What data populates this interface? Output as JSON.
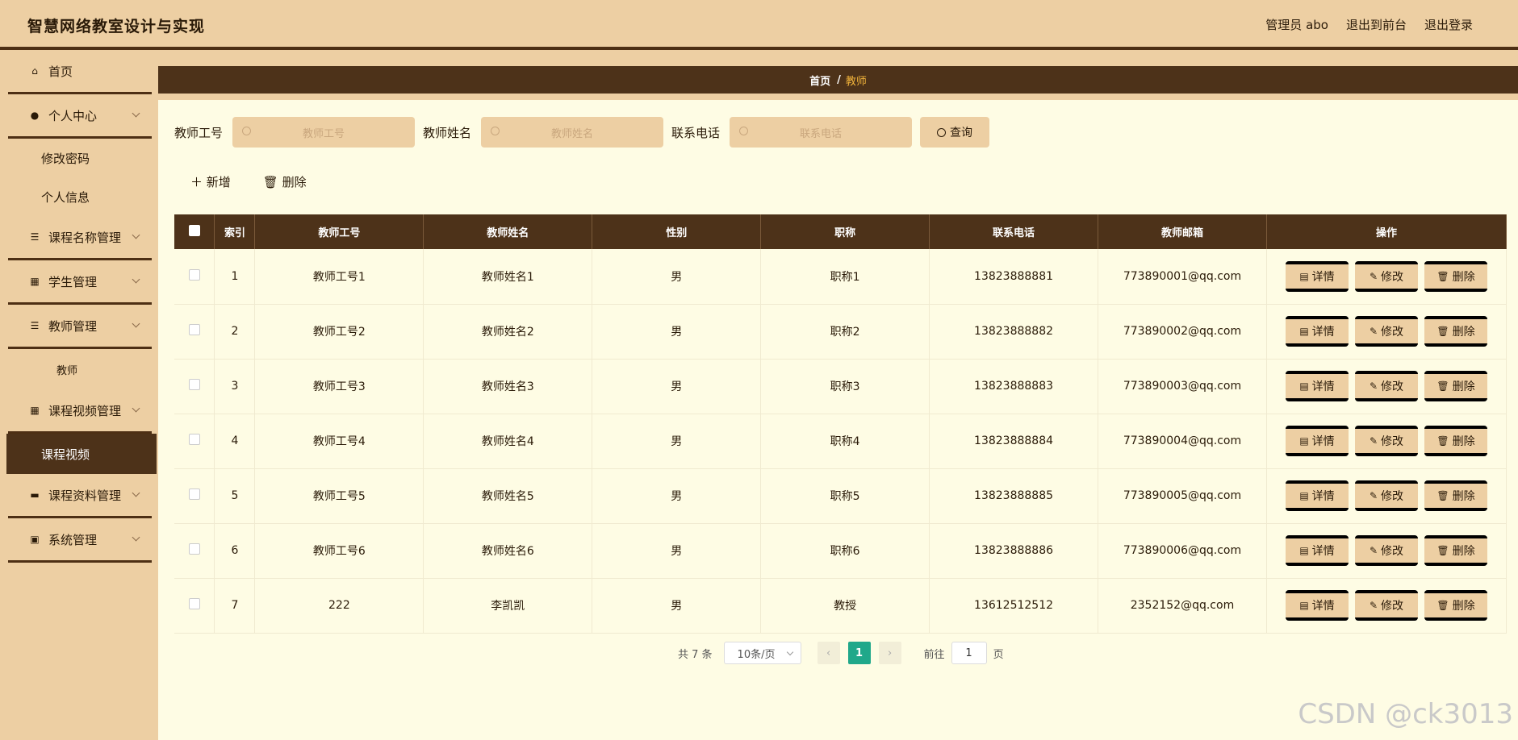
{
  "app": {
    "title": "智慧网络教室设计与实现"
  },
  "topnav": {
    "user": "管理员 abo",
    "front": "退出到前台",
    "logout": "退出登录"
  },
  "sidebar": {
    "home": "首页",
    "personal": "个人中心",
    "change_pwd": "修改密码",
    "profile": "个人信息",
    "course_name": "课程名称管理",
    "student": "学生管理",
    "teacher": "教师管理",
    "teacher_sub": "教师",
    "course_video": "课程视频管理",
    "course_video_sub": "课程视频",
    "course_material": "课程资料管理",
    "system": "系统管理"
  },
  "breadcrumb": {
    "home": "首页",
    "current": "教师"
  },
  "search": {
    "id_label": "教师工号",
    "id_placeholder": "教师工号",
    "name_label": "教师姓名",
    "name_placeholder": "教师姓名",
    "phone_label": "联系电话",
    "phone_placeholder": "联系电话",
    "button": "查询"
  },
  "toolbar": {
    "add": "新增",
    "delete": "删除"
  },
  "table": {
    "headers": [
      "索引",
      "教师工号",
      "教师姓名",
      "性别",
      "职称",
      "联系电话",
      "教师邮箱",
      "操作"
    ],
    "op_labels": {
      "detail": "详情",
      "edit": "修改",
      "delete": "删除"
    },
    "rows": [
      {
        "index": "1",
        "id": "教师工号1",
        "name": "教师姓名1",
        "gender": "男",
        "title": "职称1",
        "phone": "13823888881",
        "email": "773890001@qq.com"
      },
      {
        "index": "2",
        "id": "教师工号2",
        "name": "教师姓名2",
        "gender": "男",
        "title": "职称2",
        "phone": "13823888882",
        "email": "773890002@qq.com"
      },
      {
        "index": "3",
        "id": "教师工号3",
        "name": "教师姓名3",
        "gender": "男",
        "title": "职称3",
        "phone": "13823888883",
        "email": "773890003@qq.com"
      },
      {
        "index": "4",
        "id": "教师工号4",
        "name": "教师姓名4",
        "gender": "男",
        "title": "职称4",
        "phone": "13823888884",
        "email": "773890004@qq.com"
      },
      {
        "index": "5",
        "id": "教师工号5",
        "name": "教师姓名5",
        "gender": "男",
        "title": "职称5",
        "phone": "13823888885",
        "email": "773890005@qq.com"
      },
      {
        "index": "6",
        "id": "教师工号6",
        "name": "教师姓名6",
        "gender": "男",
        "title": "职称6",
        "phone": "13823888886",
        "email": "773890006@qq.com"
      },
      {
        "index": "7",
        "id": "222",
        "name": "李凯凯",
        "gender": "男",
        "title": "教授",
        "phone": "13612512512",
        "email": "2352152@qq.com"
      }
    ]
  },
  "pagination": {
    "total": "共 7 条",
    "page_size": "10条/页",
    "current": "1",
    "goto_prefix": "前往",
    "goto_value": "1",
    "goto_suffix": "页"
  },
  "watermark": "CSDN @ck3013",
  "colors": {
    "primary_dark": "#4d3219",
    "tan": "#edcfa3",
    "bg": "#fefce4",
    "page_active": "#20a88a"
  }
}
